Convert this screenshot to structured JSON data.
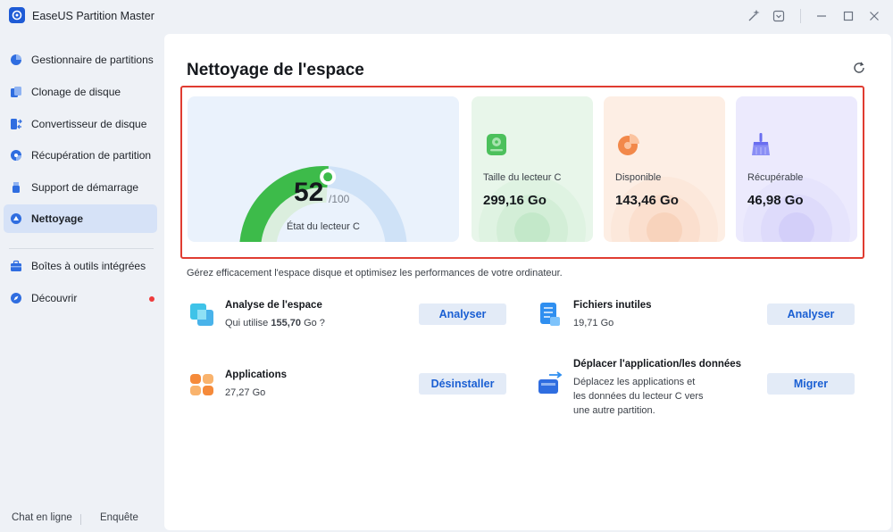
{
  "app": {
    "title": "EaseUS Partition Master"
  },
  "titlebar": {
    "icons": [
      "magic-icon",
      "dropdown-box-icon",
      "minimize-icon",
      "maximize-icon",
      "close-icon"
    ]
  },
  "sidebar": {
    "items": [
      {
        "label": "Gestionnaire de partitions",
        "icon": "pie-chart-icon"
      },
      {
        "label": "Clonage de disque",
        "icon": "disk-clone-icon"
      },
      {
        "label": "Convertisseur de disque",
        "icon": "disk-convert-icon"
      },
      {
        "label": "Récupération de partition",
        "icon": "partition-recovery-icon"
      },
      {
        "label": "Support de démarrage",
        "icon": "usb-icon"
      },
      {
        "label": "Nettoyage",
        "icon": "cleanup-icon",
        "active": true
      },
      {
        "label": "Boîtes à outils intégrées",
        "icon": "toolbox-icon"
      },
      {
        "label": "Découvrir",
        "icon": "compass-icon",
        "badge": true
      }
    ],
    "footer": {
      "chat": "Chat en ligne",
      "survey": "Enquête"
    }
  },
  "main": {
    "title": "Nettoyage de l'espace",
    "gauge": {
      "value": "52",
      "max": "/100",
      "label": "État du lecteur C",
      "fraction": 0.52
    },
    "stats": [
      {
        "label": "Taille du lecteur C",
        "value": "299,16 Go",
        "icon": "drive-icon",
        "color": "#4cc05c"
      },
      {
        "label": "Disponible",
        "value": "143,46 Go",
        "icon": "pie-icon",
        "color": "#f2884a"
      },
      {
        "label": "Récupérable",
        "value": "46,98 Go",
        "icon": "broom-icon",
        "color": "#6a6ef0"
      }
    ],
    "subtitle": "Gérez efficacement l'espace disque et optimisez les performances de votre ordinateur.",
    "tools": [
      {
        "name": "Analyse de l'espace",
        "desc_prefix": "Qui utilise ",
        "desc_bold": "155,70",
        "desc_suffix": " Go ?",
        "button": "Analyser",
        "icon": "space-analysis-icon"
      },
      {
        "name": "Fichiers inutiles",
        "desc": "19,71 Go",
        "button": "Analyser",
        "icon": "junk-files-icon"
      },
      {
        "name": "Applications",
        "desc": "27,27 Go",
        "button": "Désinstaller",
        "icon": "apps-icon"
      },
      {
        "name": "Déplacer l'application/les données",
        "desc_lines": [
          "Déplacez les applications et",
          "les données du lecteur C vers",
          "une autre partition."
        ],
        "button": "Migrer",
        "icon": "app-migrate-icon"
      }
    ]
  },
  "colors": {
    "accent": "#1a5fd3",
    "highlight": "#e03c31",
    "gauge_green": "#3dbb4a",
    "active_nav": "#d6e2f7"
  }
}
